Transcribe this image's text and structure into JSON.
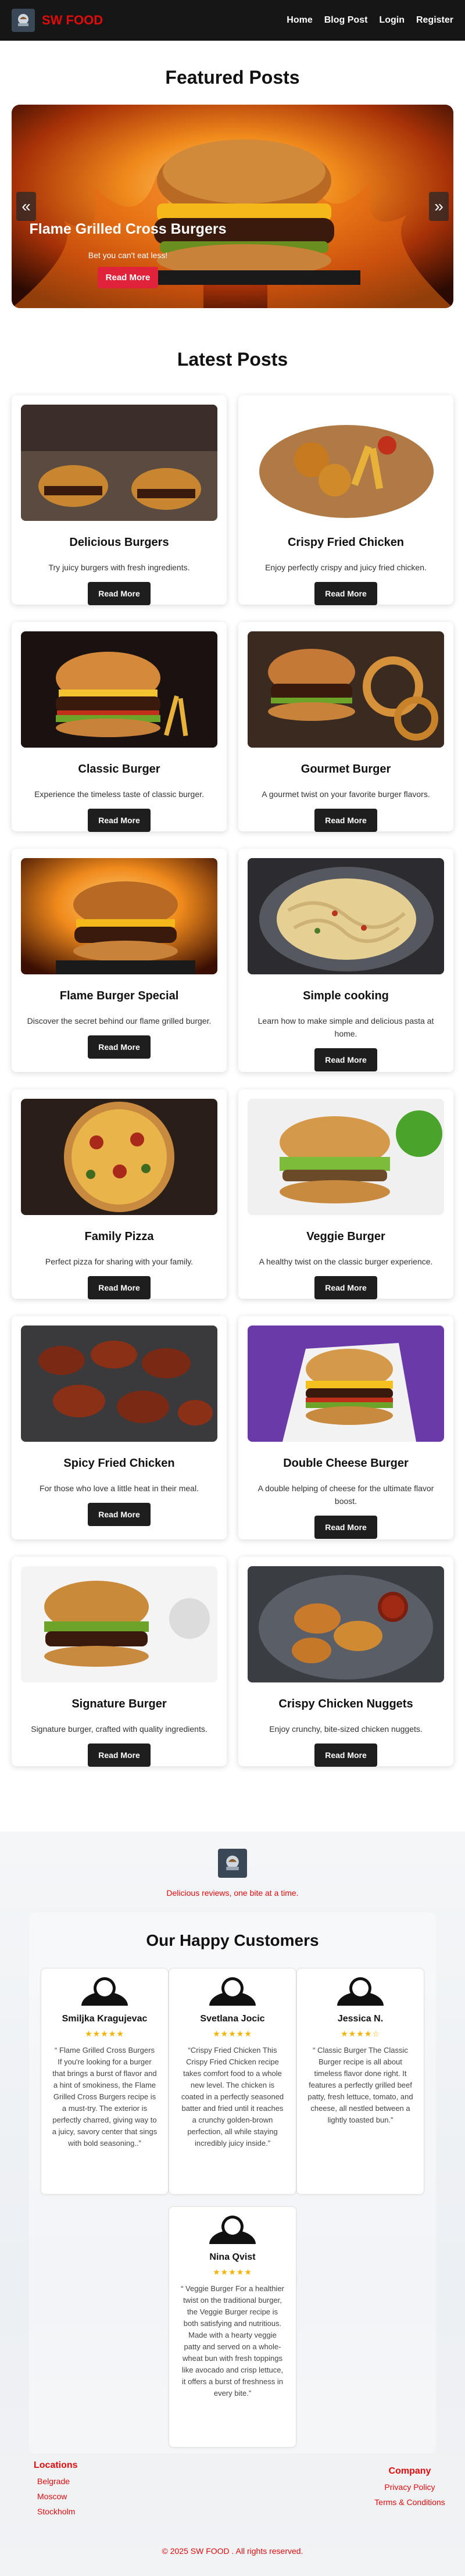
{
  "nav": {
    "brand": "SW FOOD",
    "links": [
      "Home",
      "Blog Post",
      "Login",
      "Register"
    ]
  },
  "featured": {
    "title": "Featured Posts",
    "slide_title": "Flame Grilled Cross Burgers",
    "slide_text": "Bet you can't eat less!",
    "button": "Read More",
    "prev": "«",
    "next": "»"
  },
  "latest": {
    "title": "Latest Posts",
    "button": "Read More",
    "posts": [
      {
        "title": "Delicious Burgers",
        "desc": "Try juicy burgers with fresh ingredients."
      },
      {
        "title": "Crispy Fried Chicken",
        "desc": "Enjoy perfectly crispy and juicy fried chicken."
      },
      {
        "title": "Classic Burger",
        "desc": "Experience the timeless taste of classic burger."
      },
      {
        "title": "Gourmet Burger",
        "desc": "A gourmet twist on your favorite burger flavors."
      },
      {
        "title": "Flame Burger Special",
        "desc": "Discover the secret behind our flame grilled burger."
      },
      {
        "title": "Simple cooking",
        "desc": "Learn how to make simple and delicious pasta at home."
      },
      {
        "title": "Family Pizza",
        "desc": "Perfect pizza for sharing with your family."
      },
      {
        "title": "Veggie Burger",
        "desc": "A healthy twist on the classic burger experience."
      },
      {
        "title": "Spicy Fried Chicken",
        "desc": "For those who love a little heat in their meal."
      },
      {
        "title": "Double Cheese Burger",
        "desc": "A double helping of cheese for the ultimate flavor boost."
      },
      {
        "title": "Signature Burger",
        "desc": "Signature burger, crafted with quality ingredients."
      },
      {
        "title": "Crispy Chicken Nuggets",
        "desc": "Enjoy crunchy, bite-sized chicken nuggets."
      }
    ]
  },
  "about": {
    "tagline": "Delicious reviews, one bite at a time."
  },
  "customers": {
    "title": "Our Happy Customers",
    "reviews": [
      {
        "name": "Smiljka Kragujevac",
        "stars": "★★★★★",
        "text": "“ Flame Grilled Cross Burgers If you're looking for a burger that brings a burst of flavor and a hint of smokiness, the Flame Grilled Cross Burgers recipe is a must-try. The exterior is perfectly charred, giving way to a juicy, savory center that sings with bold seasoning..”"
      },
      {
        "name": "Svetlana Jocic",
        "stars": "★★★★★",
        "text": "“Crispy Fried Chicken This Crispy Fried Chicken recipe takes comfort food to a whole new level. The chicken is coated in a perfectly seasoned batter and fried until it reaches a crunchy golden-brown perfection, all while staying incredibly juicy inside.”"
      },
      {
        "name": "Jessica N.",
        "stars": "★★★★☆",
        "text": "“ Classic Burger The Classic Burger recipe is all about timeless flavor done right. It features a perfectly grilled beef patty, fresh lettuce, tomato, and cheese, all nestled between a lightly toasted bun.”"
      },
      {
        "name": "Nina Qvist",
        "stars": "★★★★★",
        "text": "“ Veggie Burger For a healthier twist on the traditional burger, the Veggie Burger recipe is both satisfying and nutritious. Made with a hearty veggie patty and served on a whole-wheat bun with fresh toppings like avocado and crisp lettuce, it offers a burst of freshness in every bite.”"
      }
    ]
  },
  "footer": {
    "locations_title": "Locations",
    "locations": [
      "Belgrade",
      "Moscow",
      "Stockholm"
    ],
    "company_title": "Company",
    "company_links": [
      "Privacy Policy",
      "Terms & Conditions"
    ],
    "copyright": "© 2025 SW FOOD . All rights reserved."
  },
  "colors": {
    "brand_red": "#e10b0b",
    "nav_bg": "#161616",
    "button_red": "#e0233a",
    "button_dark": "#1e1e1e",
    "star": "#f5b301"
  }
}
